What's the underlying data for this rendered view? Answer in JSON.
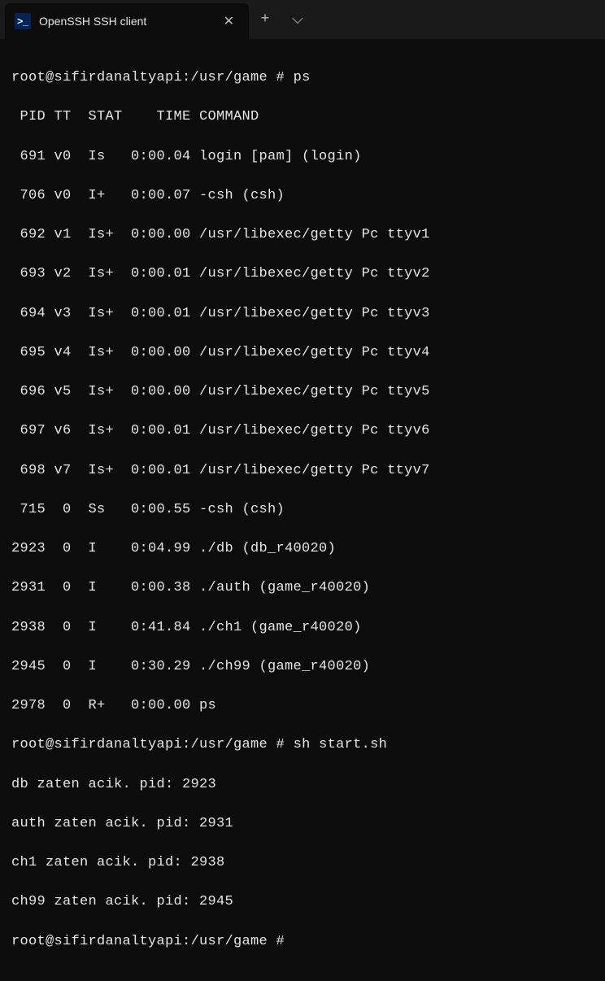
{
  "titlebar": {
    "tab_title": "OpenSSH SSH client",
    "tab_icon_text": ">_",
    "close_glyph": "✕",
    "new_tab_glyph": "+",
    "dropdown_glyph": "⌵"
  },
  "terminal": {
    "prompt_prefix": "root@sifirdanaltyapi:/usr/game # ",
    "commands": {
      "ps": "ps",
      "start": "sh start.sh"
    },
    "ps_header": " PID TT  STAT    TIME COMMAND",
    "ps_rows": [
      " 691 v0  Is   0:00.04 login [pam] (login)",
      " 706 v0  I+   0:00.07 -csh (csh)",
      " 692 v1  Is+  0:00.00 /usr/libexec/getty Pc ttyv1",
      " 693 v2  Is+  0:00.01 /usr/libexec/getty Pc ttyv2",
      " 694 v3  Is+  0:00.01 /usr/libexec/getty Pc ttyv3",
      " 695 v4  Is+  0:00.00 /usr/libexec/getty Pc ttyv4",
      " 696 v5  Is+  0:00.00 /usr/libexec/getty Pc ttyv5",
      " 697 v6  Is+  0:00.01 /usr/libexec/getty Pc ttyv6",
      " 698 v7  Is+  0:00.01 /usr/libexec/getty Pc ttyv7",
      " 715  0  Ss   0:00.55 -csh (csh)",
      "2923  0  I    0:04.99 ./db (db_r40020)",
      "2931  0  I    0:00.38 ./auth (game_r40020)",
      "2938  0  I    0:41.84 ./ch1 (game_r40020)",
      "2945  0  I    0:30.29 ./ch99 (game_r40020)",
      "2978  0  R+   0:00.00 ps"
    ],
    "script_output": [
      "db zaten acik. pid: 2923",
      "auth zaten acik. pid: 2931",
      "ch1 zaten acik. pid: 2938",
      "ch99 zaten acik. pid: 2945"
    ]
  }
}
